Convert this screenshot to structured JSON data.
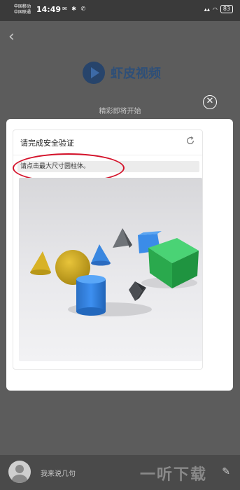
{
  "status": {
    "carrier1": "中国移动",
    "carrier2": "中国联通",
    "time": "14:49",
    "battery": "83"
  },
  "background": {
    "app_name": "虾皮视频",
    "loading_text": "精彩即将开始"
  },
  "captcha": {
    "title": "请完成安全验证",
    "instruction": "请点击最大尺寸圆柱体。"
  },
  "bottom": {
    "comment_placeholder": "我来说几句"
  },
  "watermark": {
    "text": "一听下载"
  },
  "colors": {
    "annotation": "#d4122a",
    "logo": "#2e4f78"
  }
}
